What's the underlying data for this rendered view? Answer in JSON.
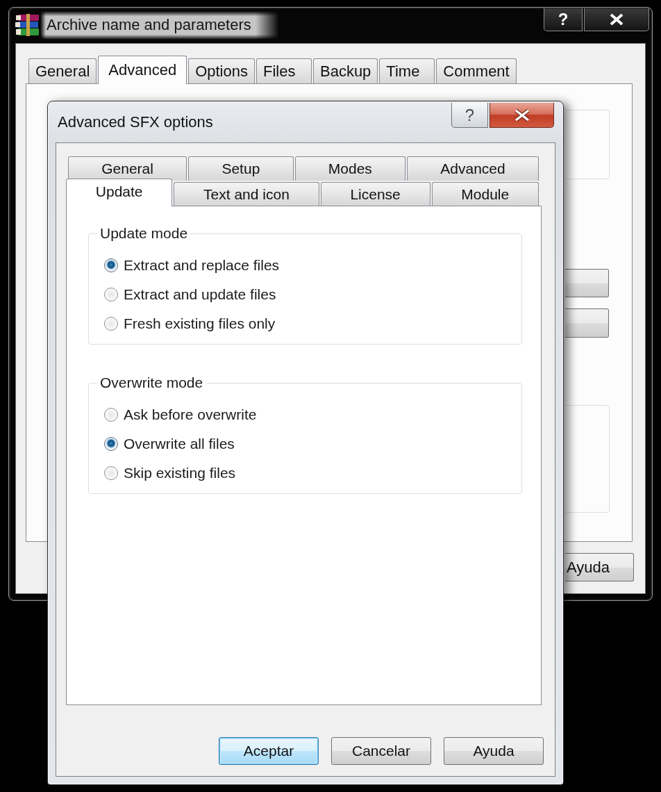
{
  "back_window": {
    "title": "Archive name and parameters",
    "help_button": "?",
    "tabs": [
      {
        "label": "General",
        "selected": false
      },
      {
        "label": "Advanced",
        "selected": true
      },
      {
        "label": "Options",
        "selected": false
      },
      {
        "label": "Files",
        "selected": false
      },
      {
        "label": "Backup",
        "selected": false
      },
      {
        "label": "Time",
        "selected": false
      },
      {
        "label": "Comment",
        "selected": false
      }
    ],
    "buttons": [
      "Ayuda"
    ]
  },
  "dialog": {
    "title": "Advanced SFX options",
    "help_button": "?",
    "tab_rows": [
      {
        "tabs": [
          {
            "label": "General",
            "selected": false
          },
          {
            "label": "Setup",
            "selected": false
          },
          {
            "label": "Modes",
            "selected": false
          },
          {
            "label": "Advanced",
            "selected": false
          }
        ]
      },
      {
        "tabs": [
          {
            "label": "Update",
            "selected": true
          },
          {
            "label": "Text and icon",
            "selected": false
          },
          {
            "label": "License",
            "selected": false
          },
          {
            "label": "Module",
            "selected": false
          }
        ]
      }
    ],
    "groups": [
      {
        "title": "Update mode",
        "options": [
          {
            "label": "Extract and replace files",
            "selected": true
          },
          {
            "label": "Extract and update files",
            "selected": false
          },
          {
            "label": "Fresh existing files only",
            "selected": false
          }
        ]
      },
      {
        "title": "Overwrite mode",
        "options": [
          {
            "label": "Ask before overwrite",
            "selected": false
          },
          {
            "label": "Overwrite all files",
            "selected": true
          },
          {
            "label": "Skip existing files",
            "selected": false
          }
        ]
      }
    ],
    "buttons": [
      {
        "label": "Aceptar",
        "default": true
      },
      {
        "label": "Cancelar",
        "default": false
      },
      {
        "label": "Ayuda",
        "default": false
      }
    ]
  }
}
